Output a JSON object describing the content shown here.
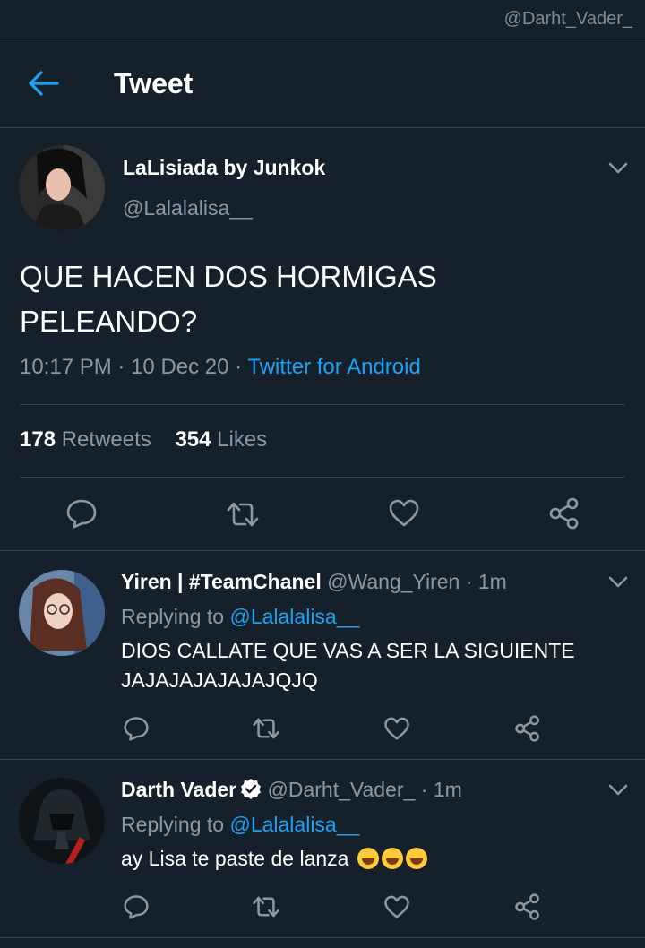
{
  "watermark": "@Darht_Vader_",
  "header": {
    "title": "Tweet",
    "back_icon": "arrow-left-icon"
  },
  "tweet": {
    "author_name": "LaLisiada by Junkok",
    "author_handle": "@Lalalalisa__",
    "text": "QUE HACEN DOS HORMIGAS PELEANDO?",
    "time": "10:17 PM",
    "date": "10 Dec 20",
    "source": "Twitter for Android",
    "retweets_count": "178",
    "retweets_label": "Retweets",
    "likes_count": "354",
    "likes_label": "Likes"
  },
  "replies": [
    {
      "name": "Yiren | #TeamChanel",
      "handle": "@Wang_Yiren",
      "time": "1m",
      "replying_prefix": "Replying to",
      "replying_to": "@Lalalalisa__",
      "text": "DIOS CALLATE QUE VAS A SER LA SIGUIENTE JAJAJAJAJAJAJQJQ"
    },
    {
      "name": "Darth Vader",
      "verified": true,
      "handle": "@Darht_Vader_",
      "time": "1m",
      "replying_prefix": "Replying to",
      "replying_to": "@Lalalalisa__",
      "text": "ay Lisa te paste de lanza",
      "emoji_count": 3
    }
  ],
  "separator": "·",
  "colors": {
    "background": "#15202b",
    "accent": "#1da1f2",
    "muted": "#8899a6",
    "divider": "#38444d"
  }
}
